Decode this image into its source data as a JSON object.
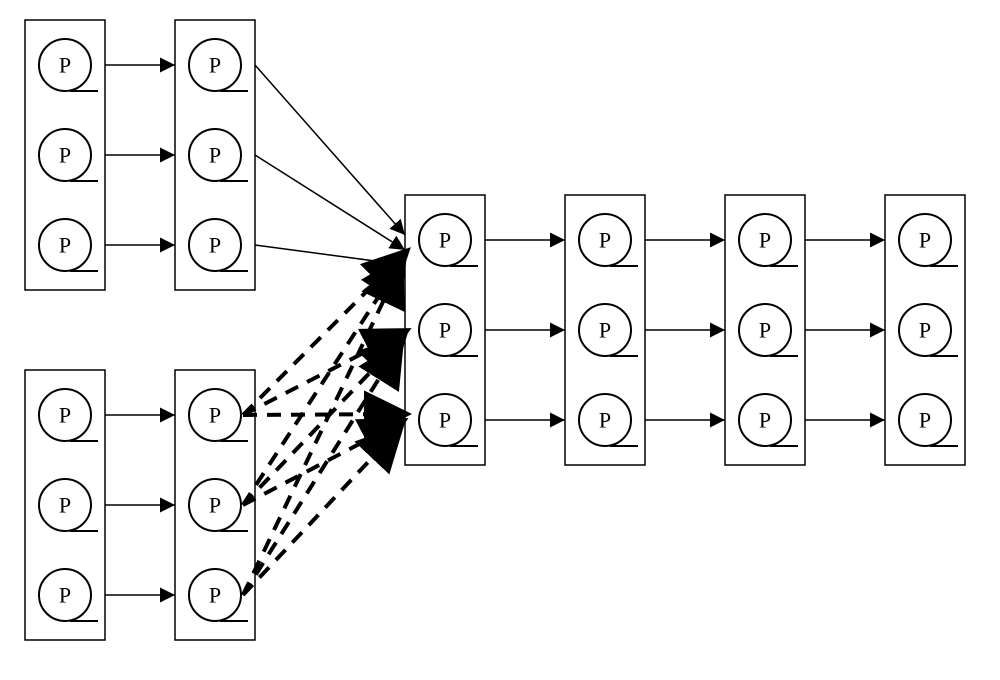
{
  "glyph": "P",
  "chart_data": {
    "type": "diagram",
    "title": "",
    "description": "Process flow of P-nodes arranged in rectangular column groups with directed connections. Two upstream branches (each two columns of 3 P-nodes) merge into a downstream chain of four columns of 3 P-nodes. Solid thin arrows denote direct one-to-one connections; bold dashed arrows denote the cross connections from the lower second-stage column to the merged third stage.",
    "columns": [
      {
        "id": "A1",
        "group": "upper",
        "stage": 1,
        "nodes": 3
      },
      {
        "id": "A2",
        "group": "upper",
        "stage": 2,
        "nodes": 3
      },
      {
        "id": "B1",
        "group": "lower",
        "stage": 1,
        "nodes": 3
      },
      {
        "id": "B2",
        "group": "lower",
        "stage": 2,
        "nodes": 3
      },
      {
        "id": "C",
        "group": "merged",
        "stage": 3,
        "nodes": 3
      },
      {
        "id": "D",
        "group": "merged",
        "stage": 4,
        "nodes": 3
      },
      {
        "id": "E",
        "group": "merged",
        "stage": 5,
        "nodes": 3
      },
      {
        "id": "F",
        "group": "merged",
        "stage": 6,
        "nodes": 3
      }
    ],
    "edges_solid": [
      [
        "A1.1",
        "A2.1"
      ],
      [
        "A1.2",
        "A2.2"
      ],
      [
        "A1.3",
        "A2.3"
      ],
      [
        "B1.1",
        "B2.1"
      ],
      [
        "B1.2",
        "B2.2"
      ],
      [
        "B1.3",
        "B2.3"
      ],
      [
        "A2.1",
        "C.1"
      ],
      [
        "A2.2",
        "C.1"
      ],
      [
        "A2.3",
        "C.1"
      ],
      [
        "A2.1",
        "C.2"
      ],
      [
        "A2.2",
        "C.2"
      ],
      [
        "A2.3",
        "C.2"
      ],
      [
        "A2.1",
        "C.3"
      ],
      [
        "A2.2",
        "C.3"
      ],
      [
        "A2.3",
        "C.3"
      ],
      [
        "C.1",
        "D.1"
      ],
      [
        "C.2",
        "D.2"
      ],
      [
        "C.3",
        "D.3"
      ],
      [
        "D.1",
        "E.1"
      ],
      [
        "D.2",
        "E.2"
      ],
      [
        "D.3",
        "E.3"
      ],
      [
        "E.1",
        "F.1"
      ],
      [
        "E.2",
        "F.2"
      ],
      [
        "E.3",
        "F.3"
      ]
    ],
    "edges_dashed": [
      [
        "B2.1",
        "C.1"
      ],
      [
        "B2.1",
        "C.2"
      ],
      [
        "B2.1",
        "C.3"
      ],
      [
        "B2.2",
        "C.1"
      ],
      [
        "B2.2",
        "C.2"
      ],
      [
        "B2.2",
        "C.3"
      ],
      [
        "B2.3",
        "C.1"
      ],
      [
        "B2.3",
        "C.2"
      ],
      [
        "B2.3",
        "C.3"
      ]
    ]
  }
}
